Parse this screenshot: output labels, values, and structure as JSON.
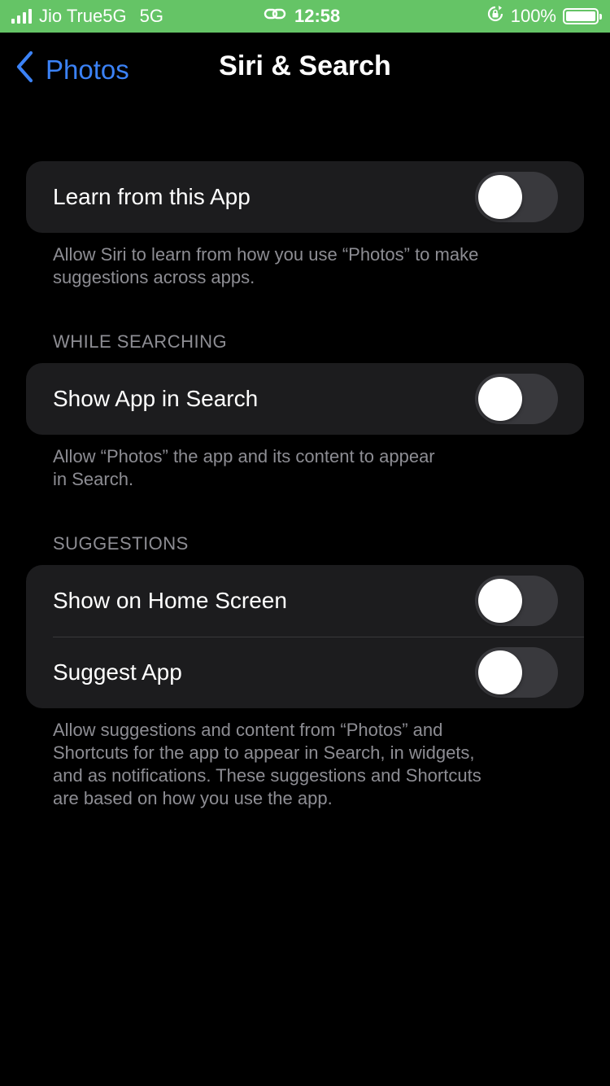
{
  "status_bar": {
    "carrier": "Jio True5G",
    "network": "5G",
    "time": "12:58",
    "battery": "100%",
    "battery_level": 1.0,
    "background_color": "#65c466",
    "icons": [
      "signal-icon",
      "link-icon",
      "rotation-lock-icon",
      "battery-icon"
    ]
  },
  "nav": {
    "back_label": "Photos",
    "title": "Siri & Search",
    "accent_color": "#3b82f6"
  },
  "groups": {
    "learn": {
      "row_label": "Learn from this App",
      "toggle_on": false,
      "footnote_line1": "Allow Siri to learn from how you use “Photos” to make",
      "footnote_line2": "suggestions across apps."
    },
    "while_searching": {
      "header": "WHILE SEARCHING",
      "row_label": "Show App in Search",
      "toggle_on": false,
      "footnote_line1": "Allow “Photos” the app and its content to appear",
      "footnote_line2": "in Search."
    },
    "suggestions": {
      "header": "SUGGESTIONS",
      "rows": [
        {
          "label": "Show on Home Screen",
          "toggle_on": false
        },
        {
          "label": "Suggest App",
          "toggle_on": false
        }
      ],
      "footnote_line1": "Allow suggestions and content from “Photos” and",
      "footnote_line2": "Shortcuts for the app to appear in Search, in widgets,",
      "footnote_line3": "and as notifications. These suggestions and Shortcuts",
      "footnote_line4": "are based on how you use the app."
    }
  }
}
